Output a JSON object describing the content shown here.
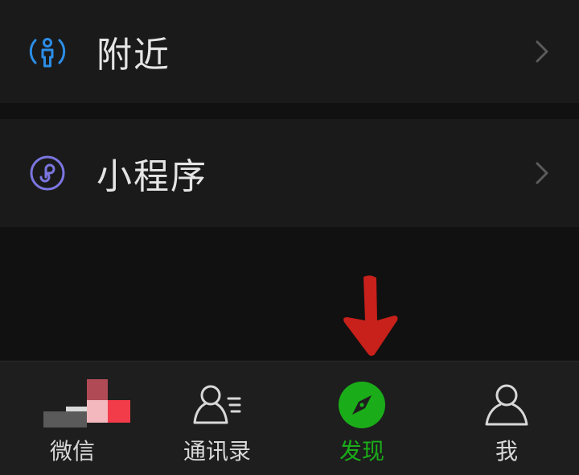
{
  "rows": [
    {
      "label": "附近",
      "icon": "nearby-person-icon",
      "color": "#2b8ee8"
    },
    {
      "label": "小程序",
      "icon": "mini-program-icon",
      "color": "#7b76e0"
    }
  ],
  "tabbar": {
    "tabs": [
      {
        "label": "微信",
        "icon": "chat-icon",
        "active": false
      },
      {
        "label": "通讯录",
        "icon": "contacts-icon",
        "active": false
      },
      {
        "label": "发现",
        "icon": "compass-icon",
        "active": true
      },
      {
        "label": "我",
        "icon": "me-icon",
        "active": false
      }
    ]
  },
  "colors": {
    "accent": "#1aad19",
    "annotation_arrow": "#c8201a",
    "background": "#111111",
    "row_background": "#1a1a1a"
  }
}
